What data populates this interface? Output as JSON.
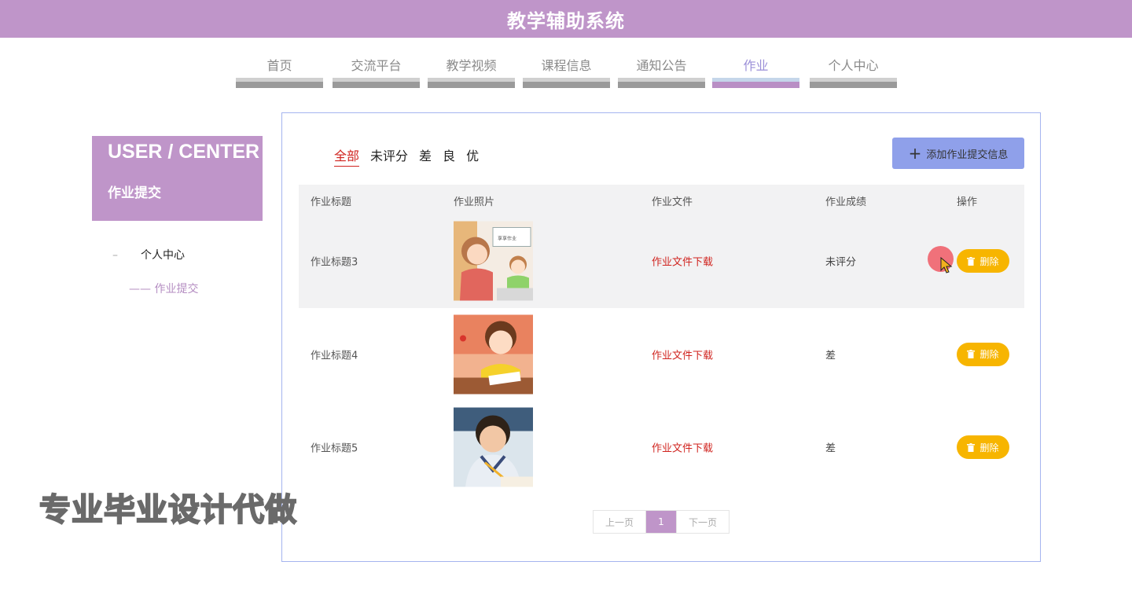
{
  "app": {
    "title": "教学辅助系统"
  },
  "nav": {
    "items": [
      {
        "label": "首页"
      },
      {
        "label": "交流平台"
      },
      {
        "label": "教学视频"
      },
      {
        "label": "课程信息"
      },
      {
        "label": "通知公告"
      },
      {
        "label": "作业",
        "active": true
      },
      {
        "label": "个人中心"
      }
    ]
  },
  "sidebar": {
    "header_en": "USER / CENTER",
    "header_cn": "作业提交",
    "menu": [
      {
        "label": "个人中心"
      },
      {
        "label": "—— 作业提交"
      }
    ]
  },
  "filters": [
    "全部",
    "未评分",
    "差",
    "良",
    "优"
  ],
  "active_filter": "全部",
  "add_button": {
    "label": "添加作业提交信息"
  },
  "table": {
    "headers": [
      "作业标题",
      "作业照片",
      "作业文件",
      "作业成绩",
      "操作"
    ],
    "rows": [
      {
        "title": "作业标题3",
        "file": "作业文件下载",
        "score": "未评分",
        "action": "删除",
        "photo": "teacher-student-illustration"
      },
      {
        "title": "作业标题4",
        "file": "作业文件下载",
        "score": "差",
        "action": "删除",
        "photo": "girl-writing-illustration"
      },
      {
        "title": "作业标题5",
        "file": "作业文件下载",
        "score": "差",
        "action": "删除",
        "photo": "boy-writing-photo"
      }
    ]
  },
  "pager": {
    "prev": "上一页",
    "current": "1",
    "next": "下一页"
  },
  "watermark": "专业毕业设计代做",
  "colors": {
    "brand": "#bf95c9",
    "accent_button": "#8fa0ea",
    "delete": "#f7b500",
    "link_red": "#d0241f"
  }
}
